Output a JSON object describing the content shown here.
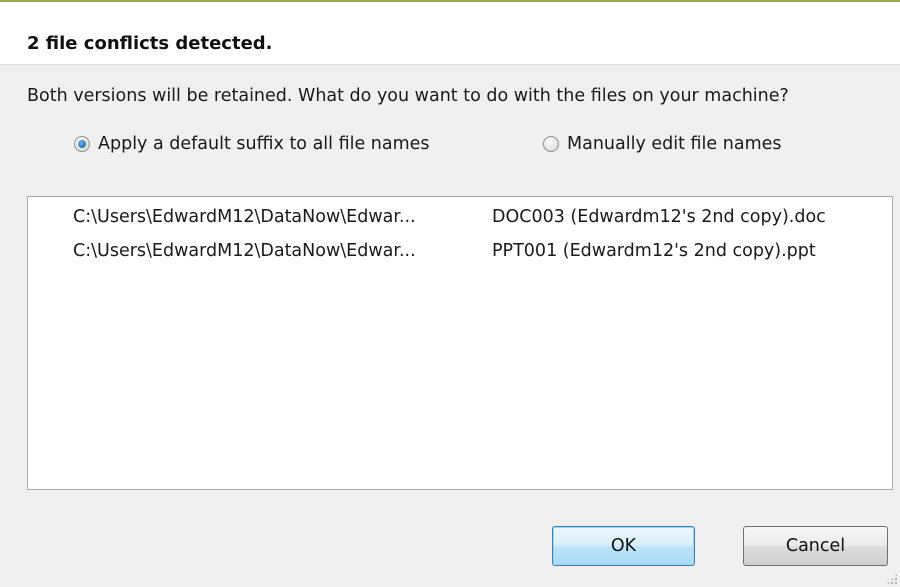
{
  "dialog": {
    "title": "2 file conflicts detected.",
    "question": "Both versions will be retained. What do you want to do with the files on your machine?"
  },
  "options": [
    {
      "label": "Apply a default suffix to all file names",
      "selected": true
    },
    {
      "label": "Manually edit file names",
      "selected": false
    }
  ],
  "files": [
    {
      "path": "C:\\Users\\EdwardM12\\DataNow\\Edwar...",
      "new_name": "DOC003 (Edwardm12's 2nd copy).doc"
    },
    {
      "path": "C:\\Users\\EdwardM12\\DataNow\\Edwar...",
      "new_name": "PPT001 (Edwardm12's 2nd copy).ppt"
    }
  ],
  "buttons": {
    "ok_label": "OK",
    "cancel_label": "Cancel"
  },
  "colors": {
    "accent": "#3c7fb1",
    "top_border": "#9aa94a"
  }
}
